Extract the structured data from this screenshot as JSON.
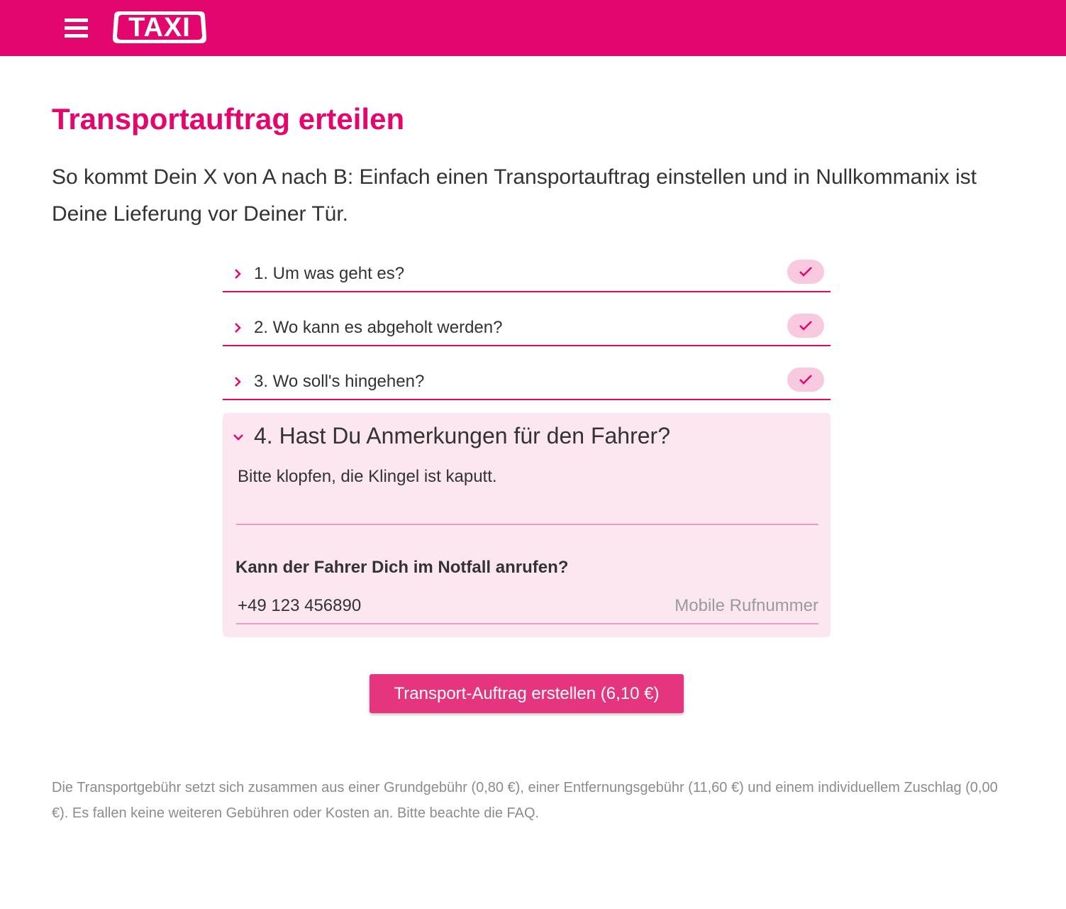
{
  "header": {
    "logo_text": "TAXI",
    "menu_icon": "hamburger-menu-icon",
    "background": "#e2066e"
  },
  "page": {
    "title": "Transportauftrag erteilen",
    "intro": "So kommt Dein X von A nach B: Einfach einen Transportauftrag einstellen und in Nullkommanix ist Deine Lieferung vor Deiner Tür."
  },
  "steps": [
    {
      "label": "1. Um was geht es?",
      "completed": true
    },
    {
      "label": "2. Wo kann es abgeholt werden?",
      "completed": true
    },
    {
      "label": "3. Wo soll's hingehen?",
      "completed": true
    }
  ],
  "step4": {
    "title": "4. Hast Du Anmerkungen für den Fahrer?",
    "expanded": true,
    "note_value": "Bitte klopfen, die Klingel ist kaputt.",
    "call_label": "Kann der Fahrer Dich im Notfall anrufen?",
    "phone_value": "+49 123 456890",
    "phone_hint": "Mobile Rufnummer"
  },
  "submit": {
    "label": "Transport-Auftrag erstellen (6,10 €)"
  },
  "fees": {
    "text": "Die Transportgebühr setzt sich zusammen aus einer Grundgebühr (0,80 €), einer Entfernungsgebühr (11,60 €) und einem individuellem Zuschlag (0,00 €). Es fallen keine weiteren Gebühren oder Kosten an. Bitte beachte die FAQ."
  },
  "colors": {
    "accent": "#e2066e",
    "button": "#e6357f",
    "panel_bg": "#fce6ef",
    "check_bg": "#f8c9df"
  }
}
